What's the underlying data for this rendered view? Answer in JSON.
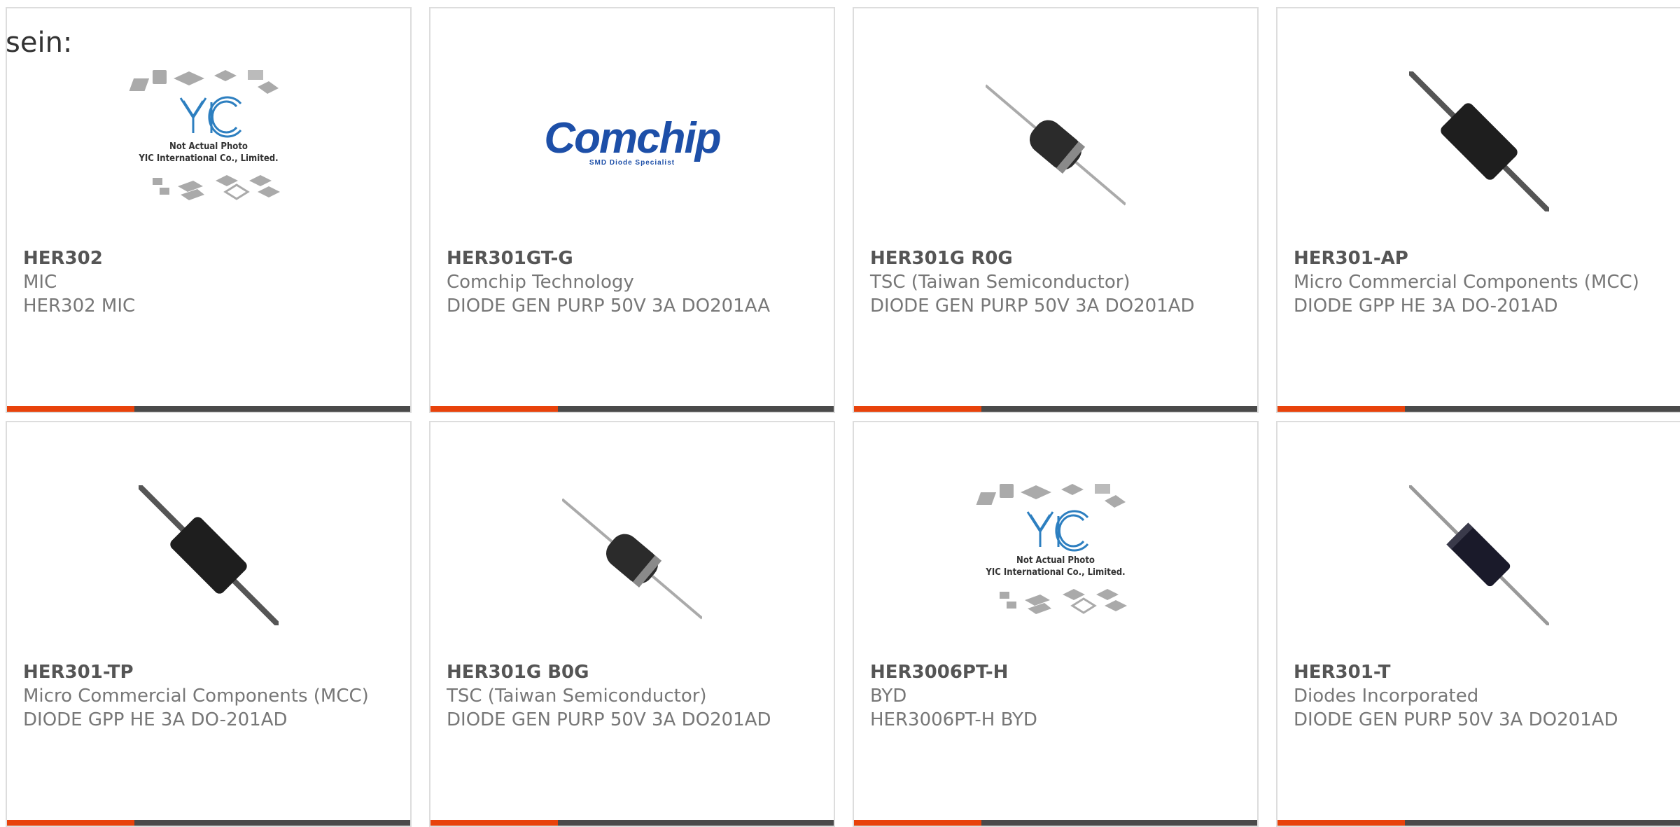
{
  "intro": "sein:",
  "colors": {
    "accent": "#e8420b",
    "bar": "#4a4a4a",
    "border": "#dddddd"
  },
  "products": [
    {
      "part": "HER302",
      "manufacturer": "MIC",
      "description": "HER302 MIC",
      "image": "yic-placeholder",
      "placeholder_lines": [
        "Not Actual Photo",
        "YIC International Co., Limited."
      ]
    },
    {
      "part": "HER301GT-G",
      "manufacturer": "Comchip Technology",
      "description": "DIODE GEN PURP 50V 3A DO201AA",
      "image": "comchip-logo",
      "logo": {
        "word": "Comchip",
        "tagline": "SMD Diode Specialist"
      }
    },
    {
      "part": "HER301G R0G",
      "manufacturer": "TSC (Taiwan Semiconductor)",
      "description": "DIODE GEN PURP 50V 3A DO201AD",
      "image": "diode-thin-banded"
    },
    {
      "part": "HER301-AP",
      "manufacturer": "Micro Commercial Components (MCC)",
      "description": "DIODE GPP HE 3A DO-201AD",
      "image": "diode-thick"
    },
    {
      "part": "HER301-TP",
      "manufacturer": "Micro Commercial Components (MCC)",
      "description": "DIODE GPP HE 3A DO-201AD",
      "image": "diode-thick"
    },
    {
      "part": "HER301G B0G",
      "manufacturer": "TSC (Taiwan Semiconductor)",
      "description": "DIODE GEN PURP 50V 3A DO201AD",
      "image": "diode-thin-banded"
    },
    {
      "part": "HER3006PT-H",
      "manufacturer": "BYD",
      "description": "HER3006PT-H BYD",
      "image": "yic-placeholder",
      "placeholder_lines": [
        "Not Actual Photo",
        "YIC International Co., Limited."
      ]
    },
    {
      "part": "HER301-T",
      "manufacturer": "Diodes Incorporated",
      "description": "DIODE GEN PURP 50V 3A DO201AD",
      "image": "diode-slim-dark"
    }
  ]
}
